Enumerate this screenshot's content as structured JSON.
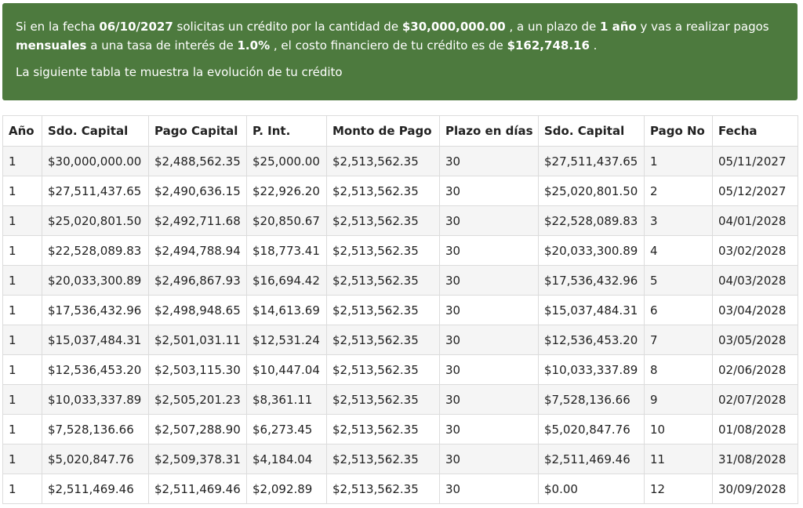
{
  "banner": {
    "t1": "Si en la fecha ",
    "date": "06/10/2027",
    "t2": " solicitas un crédito por la cantidad de ",
    "amount": "$30,000,000.00",
    "t3": " , a un plazo de ",
    "term": "1 año",
    "t4": " y vas a realizar pagos ",
    "frequency": "mensuales",
    "t5": " a una tasa de interés de ",
    "rate": "1.0%",
    "t6": " , el costo financiero de tu crédito es de ",
    "cost": "$162,748.16",
    "t7": " .",
    "subtitle": "La siguiente tabla te muestra la evolución de tu crédito"
  },
  "table": {
    "headers": [
      "Año",
      "Sdo. Capital",
      "Pago Capital",
      "P. Int.",
      "Monto de Pago",
      "Plazo en días",
      "Sdo. Capital",
      "Pago No",
      "Fecha"
    ],
    "rows": [
      [
        "1",
        "$30,000,000.00",
        "$2,488,562.35",
        "$25,000.00",
        "$2,513,562.35",
        "30",
        "$27,511,437.65",
        "1",
        "05/11/2027"
      ],
      [
        "1",
        "$27,511,437.65",
        "$2,490,636.15",
        "$22,926.20",
        "$2,513,562.35",
        "30",
        "$25,020,801.50",
        "2",
        "05/12/2027"
      ],
      [
        "1",
        "$25,020,801.50",
        "$2,492,711.68",
        "$20,850.67",
        "$2,513,562.35",
        "30",
        "$22,528,089.83",
        "3",
        "04/01/2028"
      ],
      [
        "1",
        "$22,528,089.83",
        "$2,494,788.94",
        "$18,773.41",
        "$2,513,562.35",
        "30",
        "$20,033,300.89",
        "4",
        "03/02/2028"
      ],
      [
        "1",
        "$20,033,300.89",
        "$2,496,867.93",
        "$16,694.42",
        "$2,513,562.35",
        "30",
        "$17,536,432.96",
        "5",
        "04/03/2028"
      ],
      [
        "1",
        "$17,536,432.96",
        "$2,498,948.65",
        "$14,613.69",
        "$2,513,562.35",
        "30",
        "$15,037,484.31",
        "6",
        "03/04/2028"
      ],
      [
        "1",
        "$15,037,484.31",
        "$2,501,031.11",
        "$12,531.24",
        "$2,513,562.35",
        "30",
        "$12,536,453.20",
        "7",
        "03/05/2028"
      ],
      [
        "1",
        "$12,536,453.20",
        "$2,503,115.30",
        "$10,447.04",
        "$2,513,562.35",
        "30",
        "$10,033,337.89",
        "8",
        "02/06/2028"
      ],
      [
        "1",
        "$10,033,337.89",
        "$2,505,201.23",
        "$8,361.11",
        "$2,513,562.35",
        "30",
        "$7,528,136.66",
        "9",
        "02/07/2028"
      ],
      [
        "1",
        "$7,528,136.66",
        "$2,507,288.90",
        "$6,273.45",
        "$2,513,562.35",
        "30",
        "$5,020,847.76",
        "10",
        "01/08/2028"
      ],
      [
        "1",
        "$5,020,847.76",
        "$2,509,378.31",
        "$4,184.04",
        "$2,513,562.35",
        "30",
        "$2,511,469.46",
        "11",
        "31/08/2028"
      ],
      [
        "1",
        "$2,511,469.46",
        "$2,511,469.46",
        "$2,092.89",
        "$2,513,562.35",
        "30",
        "$0.00",
        "12",
        "30/09/2028"
      ]
    ]
  },
  "colors": {
    "banner_bg": "#4d7a3e",
    "row_alt": "#f5f5f5",
    "border": "#dcdcdc"
  }
}
